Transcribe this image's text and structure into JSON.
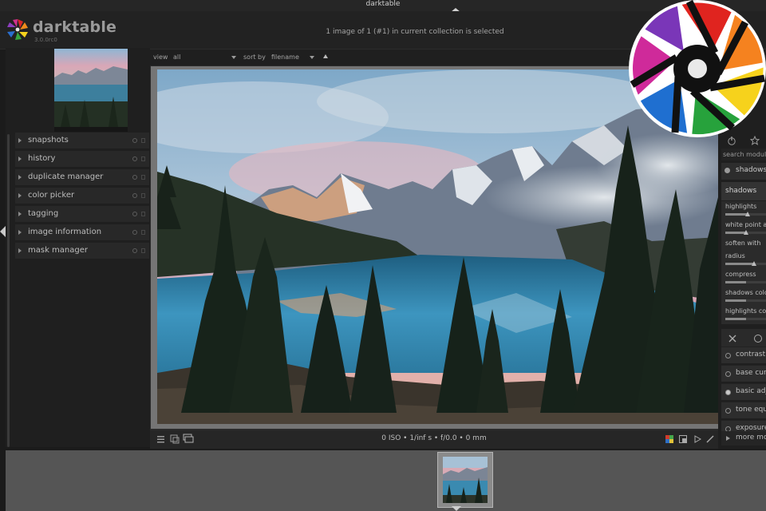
{
  "app": {
    "title": "darktable",
    "logo_text": "darktable",
    "version": "3.0.0rc0"
  },
  "header": {
    "collection_status": "1 image of 1 (#1) in current collection is selected"
  },
  "view_bar": {
    "view_label": "view",
    "view_value": "all",
    "sort_label": "sort by",
    "sort_value": "filename"
  },
  "left_modules": [
    {
      "label": "snapshots"
    },
    {
      "label": "history"
    },
    {
      "label": "duplicate manager"
    },
    {
      "label": "color picker"
    },
    {
      "label": "tagging"
    },
    {
      "label": "image information"
    },
    {
      "label": "mask manager"
    }
  ],
  "bottom_bar": {
    "exif": "0 ISO • 1/inf s • f/0.0 • 0 mm"
  },
  "right_panel": {
    "search_placeholder": "search modules",
    "active_module": "shadows",
    "group_header": "shadows",
    "sliders": [
      {
        "label": "highlights",
        "value": 0.55
      },
      {
        "label": "white point adjustment",
        "value": 0.5
      },
      {
        "label": "soften with",
        "value": 0.5
      },
      {
        "label": "radius",
        "value": 0.7
      },
      {
        "label": "compress",
        "value": 0.5
      },
      {
        "label": "shadows color adjustment",
        "value": 0.5
      },
      {
        "label": "highlights color adjustment",
        "value": 0.5
      }
    ],
    "modules": [
      {
        "label": "contrast",
        "on": false
      },
      {
        "label": "base curve",
        "on": false
      },
      {
        "label": "basic adjustments",
        "on": true
      },
      {
        "label": "tone equalizer",
        "on": false
      },
      {
        "label": "exposure",
        "on": false
      }
    ],
    "more_modules": "more modules"
  },
  "colors": {
    "accent": "#d81e05",
    "panel_bg": "#1f1f1f",
    "frame": "#757575"
  }
}
